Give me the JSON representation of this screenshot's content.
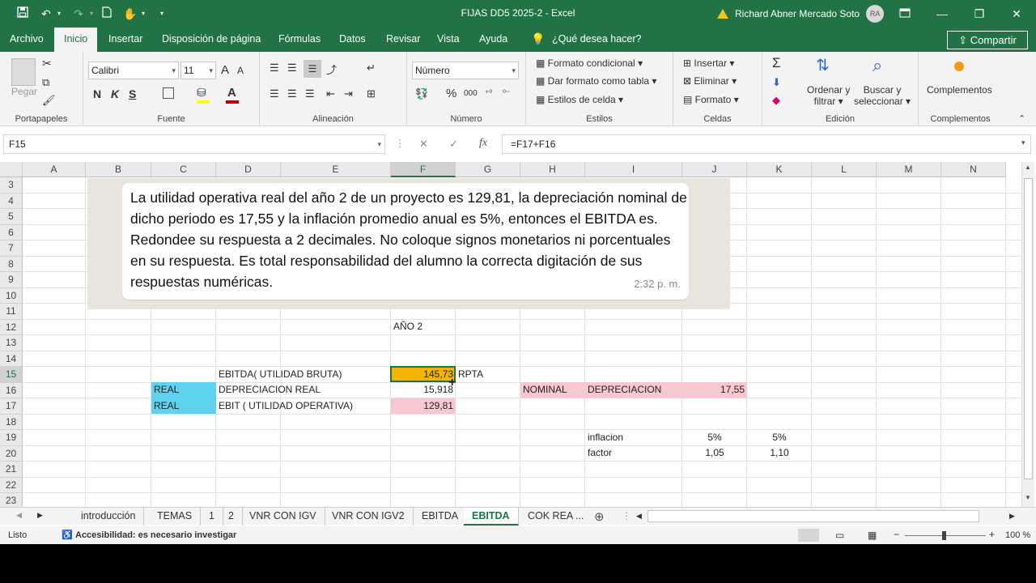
{
  "title_bar": {
    "doc_title": "FIJAS DD5 2025-2  -  Excel",
    "user_name": "Richard Abner Mercado Soto",
    "user_initials": "RA"
  },
  "ribbon_tabs": [
    "Archivo",
    "Inicio",
    "Insertar",
    "Disposición de página",
    "Fórmulas",
    "Datos",
    "Revisar",
    "Vista",
    "Ayuda",
    "¿Qué desea hacer?"
  ],
  "share_label": "Compartir",
  "ribbon": {
    "clipboard": {
      "paste": "Pegar",
      "label": "Portapapeles"
    },
    "font": {
      "name": "Calibri",
      "size": "11",
      "label": "Fuente",
      "grow": "A",
      "shrink": "A",
      "bold": "N",
      "italic": "K",
      "underline": "S"
    },
    "alignment": {
      "label": "Alineación"
    },
    "number": {
      "format": "Número",
      "label": "Número",
      "percent": "%",
      "thousands": "000"
    },
    "styles": {
      "conditional": "Formato condicional",
      "table": "Dar formato como tabla",
      "cell_styles": "Estilos de celda",
      "label": "Estilos"
    },
    "cells": {
      "insert": "Insertar",
      "delete": "Eliminar",
      "format": "Formato",
      "label": "Celdas"
    },
    "editing": {
      "sort": "Ordenar y",
      "sort2": "filtrar",
      "find": "Buscar y",
      "find2": "seleccionar",
      "label": "Edición"
    },
    "addins": {
      "addins": "Complementos",
      "label": "Complementos"
    }
  },
  "formula_bar": {
    "name_box": "F15",
    "formula": "=F17+F16",
    "fx": "fx"
  },
  "columns": [
    "A",
    "B",
    "C",
    "D",
    "E",
    "F",
    "G",
    "H",
    "I",
    "J",
    "K",
    "L",
    "M",
    "N"
  ],
  "rows": [
    "3",
    "4",
    "5",
    "6",
    "7",
    "8",
    "9",
    "10",
    "11",
    "12",
    "13",
    "14",
    "15",
    "16",
    "17",
    "18",
    "19",
    "20",
    "21",
    "22",
    "23"
  ],
  "note": {
    "text": "La utilidad operativa real del año 2 de un proyecto es 129,81, la depreciación nominal de dicho periodo es 17,55 y la inflación promedio anual es 5%, entonces el EBITDA es. Redondee su respuesta a 2 decimales. No coloque signos monetarios ni porcentuales en su respuesta. Es total responsabilidad del alumno la correcta digitación de sus respuestas numéricas.",
    "time": "2:32 p. m."
  },
  "cells": {
    "F12": "AÑO 2",
    "D15": "EBITDA( UTILIDAD BRUTA)",
    "F15": "145,73",
    "G15": "RPTA",
    "C16": "REAL",
    "D16": "DEPRECIACION REAL",
    "F16": "15,918",
    "H16": "NOMINAL",
    "I16": "DEPRECIACION",
    "J16": "17,55",
    "C17": "REAL",
    "D17": "EBIT ( UTILIDAD OPERATIVA)",
    "F17": "129,81",
    "I19": "inflacion",
    "J19": "5%",
    "K19": "5%",
    "I20": "factor",
    "J20": "1,05",
    "K20": "1,10"
  },
  "sheet_tabs": [
    "introducción",
    "TEMAS",
    "1",
    "2",
    "VNR CON IGV",
    "VNR CON IGV2",
    "EBITDA",
    "EBITDA",
    "COK REA ..."
  ],
  "status": {
    "ready": "Listo",
    "accessibility": "Accesibilidad: es necesario investigar",
    "zoom": "100 %"
  },
  "colors": {
    "excel_green": "#217346",
    "selected_fill": "#f4b400",
    "blue_fill": "#5dd3f0",
    "pink_fill": "#f8c8d0"
  }
}
